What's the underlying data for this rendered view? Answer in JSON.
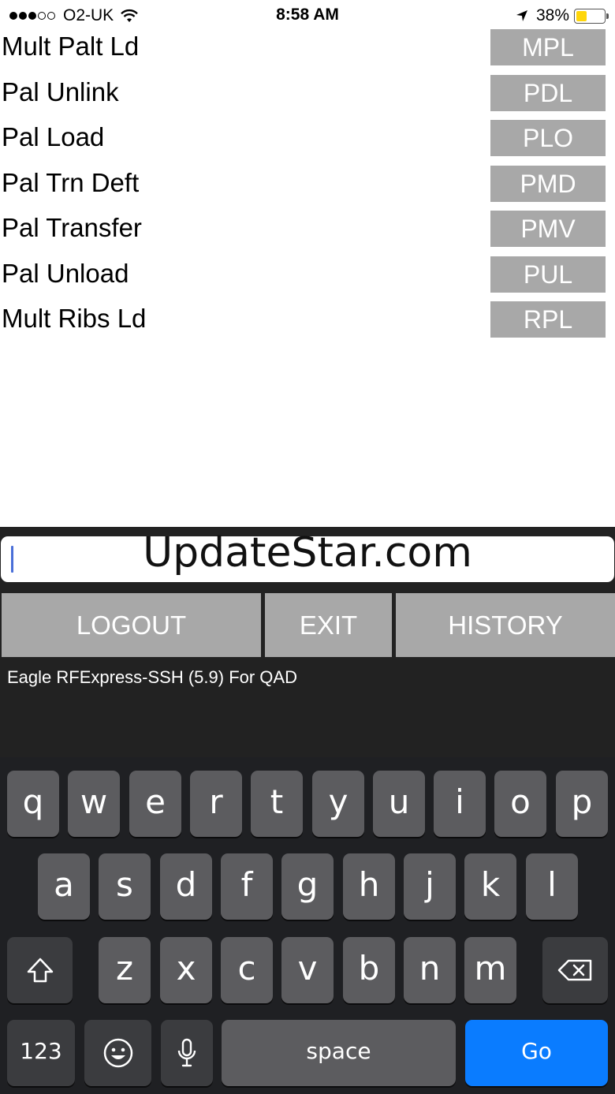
{
  "status_bar": {
    "carrier": "O2-UK",
    "time": "8:58 AM",
    "battery_percent": "38%",
    "battery_level": 0.38,
    "signal_bars_filled": 3,
    "signal_bars_total": 5
  },
  "menu": {
    "items": [
      {
        "label": "Mult Palt Ld",
        "code": "MPL"
      },
      {
        "label": "Pal Unlink",
        "code": "PDL"
      },
      {
        "label": "Pal Load",
        "code": "PLO"
      },
      {
        "label": "Pal Trn Deft",
        "code": "PMD"
      },
      {
        "label": "Pal Transfer",
        "code": "PMV"
      },
      {
        "label": "Pal Unload",
        "code": "PUL"
      },
      {
        "label": "Mult Ribs Ld",
        "code": "RPL"
      }
    ]
  },
  "command": {
    "input_value": "",
    "watermark": "UpdateStar.com"
  },
  "actions": {
    "logout": "LOGOUT",
    "exit": "EXIT",
    "history": "HISTORY"
  },
  "footer": {
    "app_info": "Eagle RFExpress-SSH (5.9) For QAD"
  },
  "keyboard": {
    "row1": [
      "q",
      "w",
      "e",
      "r",
      "t",
      "y",
      "u",
      "i",
      "o",
      "p"
    ],
    "row2": [
      "a",
      "s",
      "d",
      "f",
      "g",
      "h",
      "j",
      "k",
      "l"
    ],
    "row3": [
      "z",
      "x",
      "c",
      "v",
      "b",
      "n",
      "m"
    ],
    "numbers_key": "123",
    "space_key": "space",
    "go_key": "Go",
    "icons": {
      "shift": "shift-icon",
      "backspace": "backspace-icon",
      "emoji": "emoji-icon",
      "mic": "microphone-icon"
    }
  },
  "colors": {
    "button_gray": "#a8a8a8",
    "dark_bg": "#222222",
    "key_bg": "#5c5c5f",
    "go_blue": "#0a7cff",
    "battery_yellow": "#ffd60a"
  }
}
